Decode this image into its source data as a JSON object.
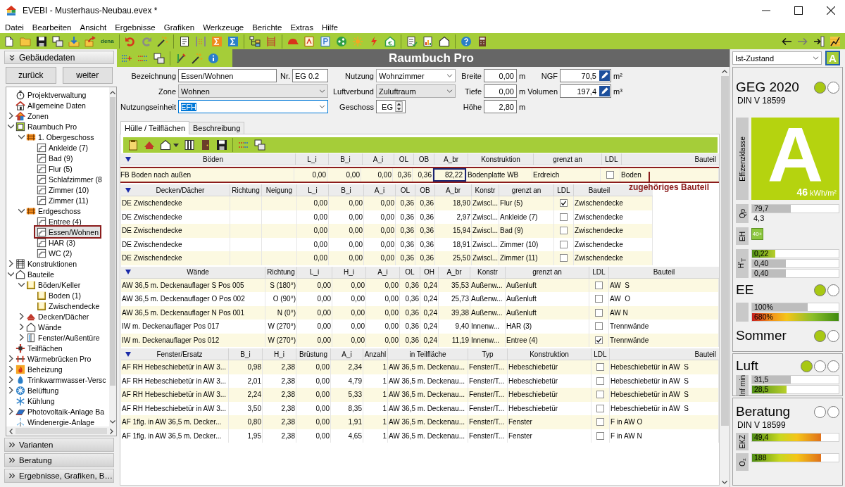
{
  "window": {
    "title": "EVEBI - Musterhaus-Neubau.evex *"
  },
  "menu": [
    "Datei",
    "Bearbeiten",
    "Ansicht",
    "Ergebnisse",
    "Grafiken",
    "Werkzeuge",
    "Berichte",
    "Extras",
    "Hilfe"
  ],
  "toolbar": {
    "logo": "dena"
  },
  "sidebar": {
    "header": "Gebäudedaten",
    "buttons": [
      "zurück",
      "weiter"
    ],
    "tree": [
      {
        "label": "Projektverwaltung",
        "kind": "stopwatch",
        "selected": false
      },
      {
        "label": "Allgemeine Daten",
        "kind": "home",
        "selected": false
      },
      {
        "label": "Zonen",
        "kind": "zone",
        "selected": false,
        "expanded": false
      },
      {
        "label": "Raumbuch Pro",
        "kind": "book",
        "selected": false,
        "expanded": true,
        "children": [
          {
            "label": "1. Obergeschoss",
            "kind": "floor",
            "selected": false,
            "expanded": true,
            "children": [
              {
                "label": "Ankleide (7)",
                "kind": "room",
                "selected": false
              },
              {
                "label": "Bad (9)",
                "kind": "room",
                "selected": false
              },
              {
                "label": "Flur (5)",
                "kind": "room",
                "selected": false
              },
              {
                "label": "Schlafzimmer (8",
                "kind": "room",
                "selected": false
              },
              {
                "label": "Zimmer (10)",
                "kind": "room",
                "selected": false
              },
              {
                "label": "Zimmer (11)",
                "kind": "room",
                "selected": false
              }
            ]
          },
          {
            "label": "Erdgeschoss",
            "kind": "floor",
            "selected": false,
            "expanded": true,
            "children": [
              {
                "label": "Entree (4)",
                "kind": "room",
                "selected": false
              },
              {
                "label": "Essen/Wohnen",
                "kind": "room",
                "selected": true,
                "highlighted": true
              },
              {
                "label": "HAR (3)",
                "kind": "room",
                "selected": false
              },
              {
                "label": "WC (2)",
                "kind": "room",
                "selected": false
              }
            ]
          }
        ]
      },
      {
        "label": "Konstruktionen",
        "kind": "layers",
        "selected": false,
        "expanded": false
      },
      {
        "label": "Bauteile",
        "kind": "outline",
        "selected": false,
        "expanded": true,
        "children": [
          {
            "label": "Böden/Keller",
            "kind": "slab",
            "selected": false,
            "expanded": true,
            "children": [
              {
                "label": "Boden (1)",
                "kind": "slab",
                "selected": false
              },
              {
                "label": "Zwischendecke",
                "kind": "slab",
                "selected": false
              }
            ]
          },
          {
            "label": "Decken/Dächer",
            "kind": "roof",
            "selected": false,
            "expanded": false
          },
          {
            "label": "Wände",
            "kind": "outline",
            "selected": false,
            "expanded": false
          },
          {
            "label": "Fenster/Außentüre",
            "kind": "window",
            "selected": false,
            "expanded": false
          }
        ]
      },
      {
        "label": "Teilflächen",
        "kind": "cross",
        "selected": false
      },
      {
        "label": "Wärmebrücken Pro",
        "kind": "bridge",
        "selected": false,
        "expanded": false
      },
      {
        "label": "Beheizung",
        "kind": "flame",
        "selected": false,
        "expanded": false
      },
      {
        "label": "Trinkwarmwasser-Versc",
        "kind": "drop",
        "selected": false,
        "expanded": false
      },
      {
        "label": "Belüftung",
        "kind": "fan",
        "selected": false,
        "expanded": false
      },
      {
        "label": "Kühlung",
        "kind": "snow",
        "selected": false
      },
      {
        "label": "Photovoltaik-Anlage Ba",
        "kind": "solar",
        "selected": false,
        "expanded": false
      },
      {
        "label": "Windenergie-Anlage",
        "kind": "wind",
        "selected": false
      }
    ],
    "panels": [
      "Varianten",
      "Beratung",
      "Ergebnisse, Grafiken, B…"
    ]
  },
  "module_title": "Raumbuch Pro",
  "form": {
    "fields": [
      {
        "label": "Bezeichnung",
        "value": "Essen/Wohnen",
        "kind": "text",
        "focused": false
      },
      {
        "label": "Nr.",
        "value": "EG 0.2",
        "kind": "text",
        "focused": false
      },
      {
        "label": "Nutzung",
        "value": "Wohnzimmer",
        "kind": "combo",
        "focused": false
      },
      {
        "label": "Breite",
        "value": "0,00",
        "unit": "m",
        "kind": "number",
        "focused": false
      },
      {
        "label": "NGF",
        "value": "70,5",
        "unit": "m²",
        "kind": "edit",
        "focused": false
      },
      {
        "label": "Zone",
        "value": "Wohnen",
        "kind": "select",
        "focused": false
      },
      {
        "label": "Luftverbund",
        "value": "Zuluftraum",
        "kind": "select",
        "focused": false
      },
      {
        "label": "Tiefe",
        "value": "0,00",
        "unit": "m",
        "kind": "number",
        "focused": false
      },
      {
        "label": "Volumen",
        "value": "197,4",
        "unit": "m³",
        "kind": "edit",
        "focused": false
      },
      {
        "label": "Nutzungseinheit",
        "value": "EFH",
        "kind": "combo",
        "focused": true
      },
      {
        "label": "Geschoss",
        "value": "EG",
        "kind": "spin",
        "focused": false
      },
      {
        "label": "Höhe",
        "value": "2,80",
        "unit": "m",
        "kind": "number",
        "focused": false
      }
    ]
  },
  "tabs": [
    {
      "label": "Hülle / Teilflächen",
      "selected": true
    },
    {
      "label": "Beschreibung",
      "selected": false
    }
  ],
  "tables": [
    {
      "columns": [
        {
          "label": "Böden",
          "kind": "text"
        },
        {
          "label": "L_i",
          "kind": "num"
        },
        {
          "label": "B_i",
          "kind": "num"
        },
        {
          "label": "A_i",
          "kind": "num"
        },
        {
          "label": "OL",
          "kind": "num"
        },
        {
          "label": "OB",
          "kind": "num"
        },
        {
          "label": "A_br",
          "kind": "num"
        },
        {
          "label": "Konstruktion",
          "kind": "text"
        },
        {
          "label": "grenzt an",
          "kind": "text"
        },
        {
          "label": "LDL",
          "kind": "check"
        },
        {
          "label": "Bauteil",
          "kind": "text"
        }
      ],
      "rows": [
        {
          "cells": [
            "FB Boden nach außen",
            "0,00",
            "0,00",
            "0,00",
            "0,36",
            "0,36",
            {
              "text": "82,22",
              "focused": true
            },
            "Bodenplatte WB",
            "Erdreich",
            "Boden"
          ],
          "checked": false,
          "highlighted": true
        }
      ]
    },
    {
      "columns": [
        {
          "label": "Decken/Dächer",
          "kind": "text"
        },
        {
          "label": "Richtung",
          "kind": "num"
        },
        {
          "label": "Neigung",
          "kind": "num"
        },
        {
          "label": "L_i",
          "kind": "num"
        },
        {
          "label": "B_i",
          "kind": "num"
        },
        {
          "label": "A_i",
          "kind": "num"
        },
        {
          "label": "OL",
          "kind": "num"
        },
        {
          "label": "OB",
          "kind": "num"
        },
        {
          "label": "A_br",
          "kind": "num"
        },
        {
          "label": "Konstr",
          "kind": "text"
        },
        {
          "label": "grenzt an",
          "kind": "text"
        },
        {
          "label": "LDL",
          "kind": "check"
        },
        {
          "label": "Bauteil",
          "kind": "text"
        }
      ],
      "rows": [
        {
          "cells": [
            "DE Zwischendecke",
            null,
            null,
            "0,00",
            "0,00",
            "0,00",
            "0,36",
            "0,36",
            "18,90",
            "Zwiscl...",
            "Flur (5)",
            "Zwischendecke"
          ],
          "checked": true
        },
        {
          "cells": [
            "DE Zwischendecke",
            null,
            null,
            "0,00",
            "0,00",
            "0,00",
            "0,36",
            "0,36",
            "2,97",
            "Zwiscl...",
            "Ankleide (7)",
            "Zwischendecke"
          ],
          "checked": false
        },
        {
          "cells": [
            "DE Zwischendecke",
            null,
            null,
            "0,00",
            "0,00",
            "0,00",
            "0,36",
            "0,36",
            "15,94",
            "Zwiscl...",
            "Bad (9)",
            "Zwischendecke"
          ],
          "checked": false
        },
        {
          "cells": [
            "DE Zwischendecke",
            null,
            null,
            "0,00",
            "0,00",
            "0,00",
            "0,36",
            "0,36",
            "18,91",
            "Zwiscl...",
            "Zimmer (10)",
            "Zwischendecke"
          ],
          "checked": false
        },
        {
          "cells": [
            "DE Zwischendecke",
            null,
            null,
            "0,00",
            "0,00",
            "0,00",
            "0,36",
            "0,36",
            "25,50",
            "Zwiscl...",
            "Zimmer (11)",
            "Zwischendecke"
          ],
          "checked": false
        }
      ]
    },
    {
      "columns": [
        {
          "label": "Wände",
          "kind": "text"
        },
        {
          "label": "Richtung",
          "kind": "num"
        },
        {
          "label": "L_i",
          "kind": "num"
        },
        {
          "label": "H_i",
          "kind": "num"
        },
        {
          "label": "A_i",
          "kind": "num"
        },
        {
          "label": "OL",
          "kind": "num"
        },
        {
          "label": "OH",
          "kind": "num"
        },
        {
          "label": "A_br",
          "kind": "num"
        },
        {
          "label": "Konstr",
          "kind": "text"
        },
        {
          "label": "grenzt an",
          "kind": "text"
        },
        {
          "label": "LDL",
          "kind": "check"
        },
        {
          "label": "Bauteil",
          "kind": "text"
        }
      ],
      "rows": [
        {
          "cells": [
            "AW 36,5 m. Deckenauflager S Pos 005",
            "S (180°)",
            "0,00",
            "0,00",
            "0,00",
            "0,36",
            "0,24",
            "35,53",
            "Außenw...",
            "Außenluft",
            "AW  S"
          ],
          "checked": false
        },
        {
          "cells": [
            "AW 36,5 m. Deckenauflager O Pos 002",
            "O (90°)",
            "0,00",
            "0,00",
            "0,00",
            "0,36",
            "0,24",
            "25,73",
            "Außenw...",
            "Außenluft",
            "AW  O"
          ],
          "checked": false
        },
        {
          "cells": [
            "AW 36,5 m. Deckenauflager N Pos 001",
            "N (0°)",
            "0,00",
            "0,00",
            "0,00",
            "0,36",
            "0,24",
            "39,38",
            "Außenw...",
            "Außenluft",
            "AW N"
          ],
          "checked": false
        },
        {
          "cells": [
            "IW m. Deckenauflager Pos 017",
            "W (270°)",
            "0,00",
            "0,00",
            "0,00",
            "0,36",
            "0,24",
            "9,40",
            "Innenw...",
            "HAR (3)",
            "Trennwände"
          ],
          "checked": false
        },
        {
          "cells": [
            "IW m. Deckenauflager Pos 012",
            "W (270°)",
            "0,00",
            "0,00",
            "0,00",
            "0,36",
            "0,24",
            "11,19",
            "Innenw...",
            "Entree (4)",
            "Trennwände"
          ],
          "checked": true
        }
      ]
    },
    {
      "columns": [
        {
          "label": "Fenster/Ersatz",
          "kind": "text"
        },
        {
          "label": "B_i",
          "kind": "num"
        },
        {
          "label": "H_i",
          "kind": "num"
        },
        {
          "label": "Brüstung",
          "kind": "num"
        },
        {
          "label": "A_i",
          "kind": "num"
        },
        {
          "label": "Anzahl",
          "kind": "num"
        },
        {
          "label": "in Teilfläche",
          "kind": "text"
        },
        {
          "label": "Typ",
          "kind": "text"
        },
        {
          "label": "Konstruktion",
          "kind": "text"
        },
        {
          "label": "LDL",
          "kind": "check"
        },
        {
          "label": "Bauteil",
          "kind": "text"
        }
      ],
      "rows": [
        {
          "cells": [
            "AF RH Hebeschiebetür in AW 3...",
            "0,98",
            "2,38",
            "0,00",
            "2,34",
            "1",
            "AW 36,5 m. Deckenau...",
            "Fenster/T...",
            "Hebeschiebetür",
            "Hebeschiebetür in AW  S"
          ],
          "checked": false
        },
        {
          "cells": [
            "AF RH Hebeschiebetür in AW 3...",
            "2,01",
            "2,38",
            "0,00",
            "4,79",
            "1",
            "AW 36,5 m. Deckenau...",
            "Fenster/T...",
            "Hebeschiebetür",
            "Hebeschiebetür in AW  S"
          ],
          "checked": false
        },
        {
          "cells": [
            "AF RH Hebeschiebetür in AW 3...",
            "2,24",
            "2,38",
            "0,00",
            "5,33",
            "1",
            "AW 36,5 m. Deckenau...",
            "Fenster/T...",
            "Hebeschiebetür",
            "Hebeschiebetür in AW  S"
          ],
          "checked": false
        },
        {
          "cells": [
            "AF RH Hebeschiebetür in AW 3...",
            "3,50",
            "2,38",
            "0,00",
            "8,35",
            "1",
            "AW 36,5 m. Deckenau...",
            "Fenster/T...",
            "Hebeschiebetür",
            "Hebeschiebetür in AW  S"
          ],
          "checked": false
        },
        {
          "cells": [
            "AF 1flg. in AW 36,5 m. Decker...",
            "0,80",
            "2,38",
            "0,00",
            "1,91",
            "1",
            "AW 36,5 m. Deckenau...",
            "Fenster/T...",
            "Fenster",
            "F in AW O"
          ],
          "checked": false
        },
        {
          "cells": [
            "AF 1flg. in AW 36,5 m. Decker...",
            "1,95",
            "2,38",
            "0,00",
            "4,65",
            "1",
            "AW 36,5 m. Deckenau...",
            "Fenster/T...",
            "Fenster",
            "F in AW N"
          ],
          "checked": false
        }
      ]
    }
  ],
  "annotation": {
    "text": "zugehöriges Bauteil"
  },
  "status_panel": {
    "variant": "Ist-Zustand",
    "class_button": "A",
    "sections": [
      {
        "groups": [
          {
            "title": "GEG 2020",
            "subtitle": "DIN V 18599",
            "lights": [
              {
                "on": true
              },
              {
                "on": false
              }
            ],
            "efficiency": {
              "label": "Effizenzklasse",
              "class": "A",
              "value": "46",
              "unit": "kWh/m²"
            },
            "metrics": [
              {
                "label": "Qp",
                "bars": [
                  {
                    "kind": "plain",
                    "text": "79,7",
                    "level": 0.45
                  },
                  {
                    "kind": "text",
                    "text": "4,3"
                  }
                ]
              },
              {
                "label": "EH",
                "bars": [
                  {
                    "kind": "badge",
                    "text": "40+"
                  }
                ]
              },
              {
                "label": "H'$_{T}$",
                "bars": [
                  {
                    "kind": "good",
                    "text": "0,22",
                    "level": 0.27
                  },
                  {
                    "kind": "plain",
                    "text": "0,40",
                    "level": 0.39
                  },
                  {
                    "kind": "plain",
                    "text": "0,40",
                    "level": 0.39
                  }
                ]
              }
            ]
          },
          {
            "title": "EE",
            "lights": [
              {
                "on": true
              },
              {
                "on": false
              }
            ],
            "metrics": [
              {
                "bars": [
                  {
                    "kind": "plain",
                    "text": "100%",
                    "level": 0.64
                  },
                  {
                    "kind": "alert",
                    "text": "680%",
                    "level": 1
                  }
                ]
              }
            ]
          },
          {
            "title": "Sommer",
            "lights": [
              {
                "on": true
              },
              {
                "on": false
              }
            ]
          }
        ]
      },
      {
        "groups": [
          {
            "title": "Luft",
            "lights": [
              {
                "on": true
              },
              {
                "on": false
              },
              {
                "on": false
              }
            ],
            "metrics": [
              {
                "label": "Inf min",
                "bars": [
                  {
                    "kind": "plain",
                    "text": "31,5",
                    "level": 0.45
                  },
                  {
                    "kind": "good",
                    "text": "28,5",
                    "level": 0.4
                  }
                ]
              }
            ]
          }
        ]
      },
      {
        "groups": [
          {
            "title": "Beratung",
            "subtitle": "DIN V 18599",
            "lights": [
              {
                "on": false
              },
              {
                "on": false
              }
            ],
            "metrics": [
              {
                "label": "EKZ",
                "bars": [
                  {
                    "kind": "scale",
                    "text": "49,4",
                    "level": 0.8
                  }
                ]
              },
              {
                "label": "O₂",
                "bars": [
                  {
                    "kind": "scale",
                    "text": "188",
                    "level": 0.8
                  }
                ]
              }
            ]
          }
        ]
      }
    ]
  }
}
